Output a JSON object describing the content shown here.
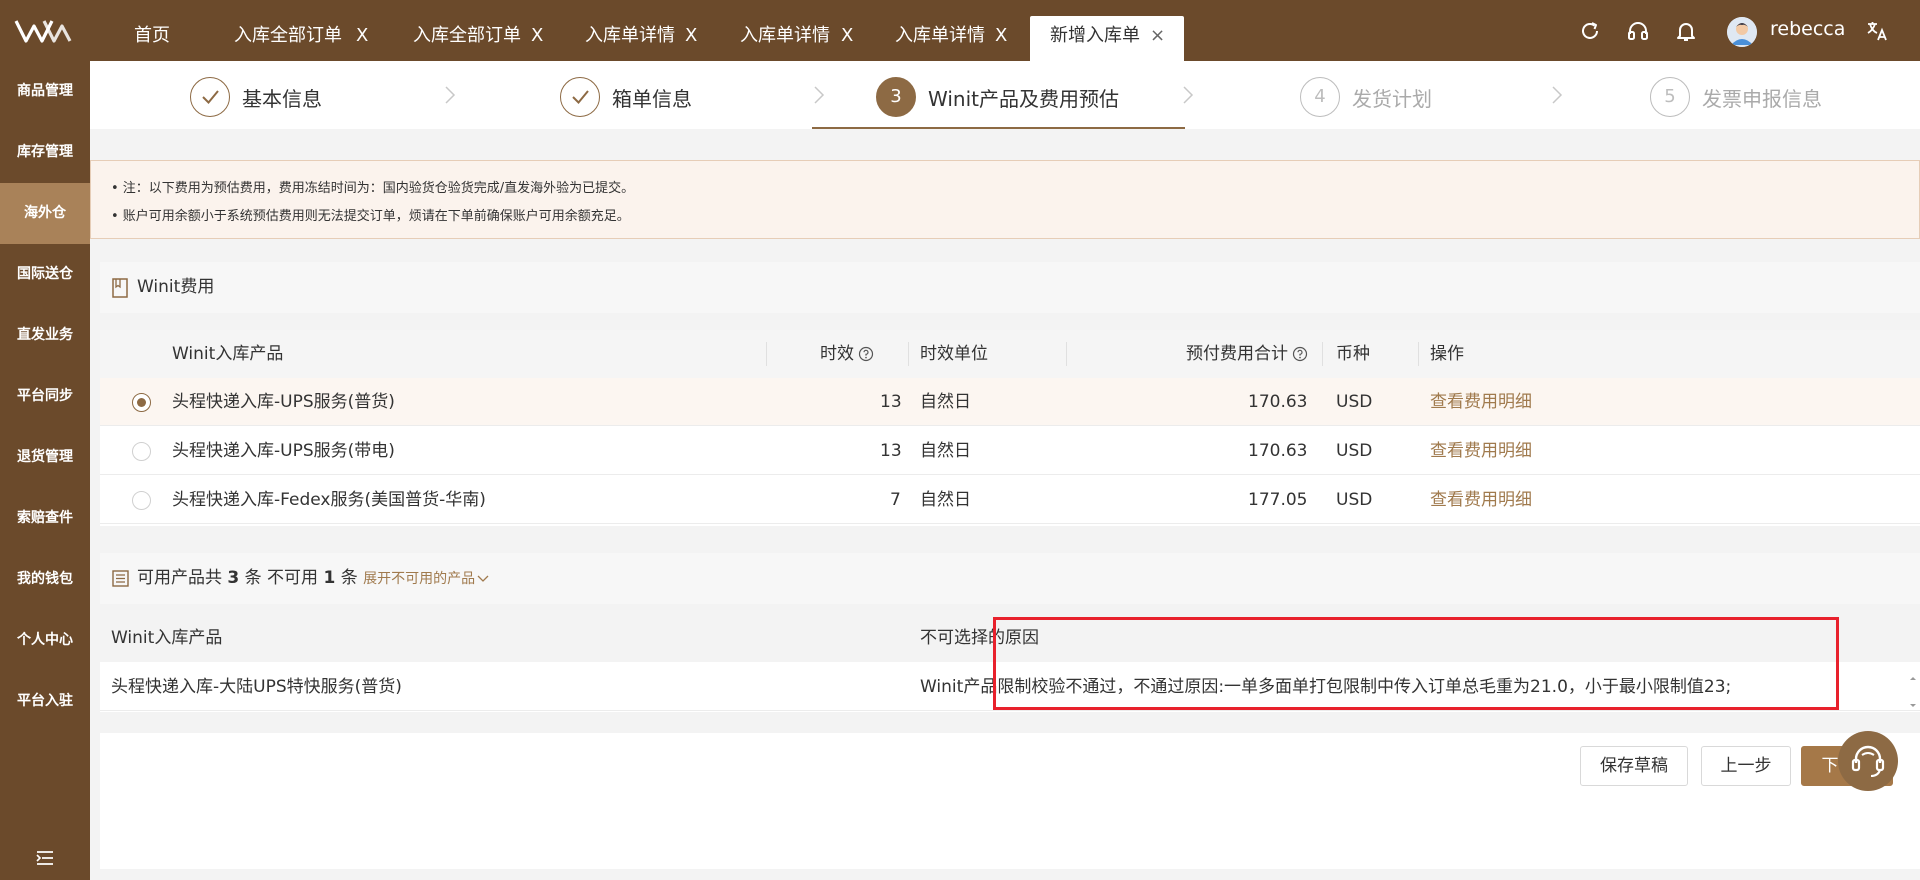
{
  "topbar": {
    "tabs": [
      {
        "label": "首页",
        "closable": false
      },
      {
        "label": "入库全部订单",
        "closable": true
      },
      {
        "label": "入库全部订单",
        "closable": true
      },
      {
        "label": "入库单详情",
        "closable": true
      },
      {
        "label": "入库单详情",
        "closable": true
      },
      {
        "label": "入库单详情",
        "closable": true
      },
      {
        "label": "新增入库单",
        "closable": true,
        "active": true
      }
    ],
    "close_glyph": "X",
    "active_close_glyph": "×",
    "username": "rebecca",
    "icons": [
      "refresh-icon",
      "headset-icon",
      "bell-icon",
      "avatar",
      "translate-icon"
    ]
  },
  "sidebar": {
    "items": [
      {
        "label": "商品管理"
      },
      {
        "label": "库存管理"
      },
      {
        "label": "海外仓",
        "active": true
      },
      {
        "label": "国际送仓"
      },
      {
        "label": "直发业务"
      },
      {
        "label": "平台同步"
      },
      {
        "label": "退货管理"
      },
      {
        "label": "索赔查件"
      },
      {
        "label": "我的钱包"
      },
      {
        "label": "个人中心"
      },
      {
        "label": "平台入驻"
      }
    ]
  },
  "steps": [
    {
      "number": "",
      "label": "基本信息",
      "status": "done"
    },
    {
      "number": "",
      "label": "箱单信息",
      "status": "done"
    },
    {
      "number": "3",
      "label": "Winit产品及费用预估",
      "status": "current"
    },
    {
      "number": "4",
      "label": "发货计划",
      "status": "todo"
    },
    {
      "number": "5",
      "label": "发票申报信息",
      "status": "todo"
    }
  ],
  "notice": {
    "line1": "• 注：以下费用为预估费用，费用冻结时间为：国内验货仓验货完成/直发海外验为已提交。",
    "line2": "• 账户可用余额小于系统预估费用则无法提交订单，烦请在下单前确保账户可用余额充足。"
  },
  "fee_section": {
    "title": "Winit费用",
    "columns": {
      "product": "Winit入库产品",
      "aging": "时效",
      "aging_unit": "时效单位",
      "total_fee": "预付费用合计",
      "currency": "币种",
      "action": "操作"
    },
    "rows": [
      {
        "product": "头程快递入库-UPS服务(普货)",
        "aging": "13",
        "unit": "自然日",
        "fee": "170.63",
        "currency": "USD",
        "action": "查看费用明细",
        "selected": true
      },
      {
        "product": "头程快递入库-UPS服务(带电)",
        "aging": "13",
        "unit": "自然日",
        "fee": "170.63",
        "currency": "USD",
        "action": "查看费用明细",
        "selected": false
      },
      {
        "product": "头程快递入库-Fedex服务(美国普货-华南)",
        "aging": "7",
        "unit": "自然日",
        "fee": "177.05",
        "currency": "USD",
        "action": "查看费用明细",
        "selected": false
      }
    ]
  },
  "availability": {
    "prefix": "可用产品共",
    "available_count": "3",
    "mid": "条 不可用",
    "unavailable_count": "1",
    "suffix": "条",
    "expand_link": "展开不可用的产品",
    "columns": {
      "product": "Winit入库产品",
      "reason": "不可选择的原因"
    },
    "rows": [
      {
        "product": "头程快递入库-大陆UPS特快服务(普货)",
        "reason": "Winit产品限制校验不通过，不通过原因:一单多面单打包限制中传入订单总毛重为21.0，小于最小限制值23;"
      }
    ]
  },
  "actions": {
    "save_draft": "保存草稿",
    "prev_step": "上一步",
    "next_step": "下一步"
  },
  "colors": {
    "brand": "#6b4a2b",
    "accent": "#8d6a44",
    "link": "#a07a4d",
    "highlight_box": "#e8212c"
  }
}
